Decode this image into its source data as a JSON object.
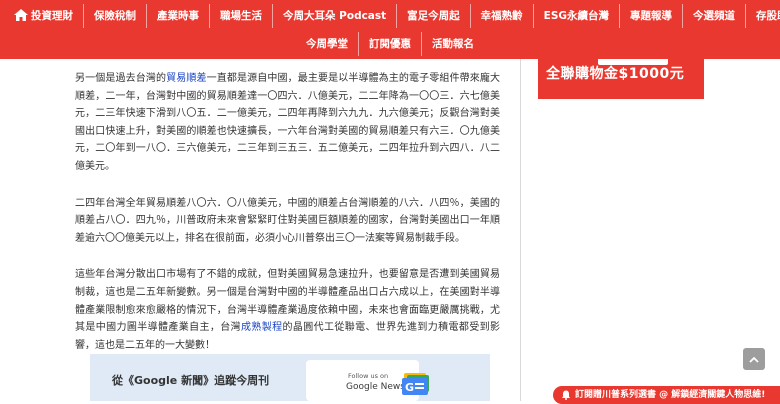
{
  "nav": {
    "row1": [
      "投資理財",
      "保險稅制",
      "產業時事",
      "職場生活",
      "今周大耳朵 Podcast",
      "富足今周起",
      "幸福熟齡",
      "ESG永續台灣",
      "專題報導",
      "今選頻道",
      "存股助理"
    ],
    "row2": [
      "今周學堂",
      "訂閱優惠",
      "活動報名"
    ]
  },
  "article": {
    "p1_a": "另一個是過去台灣的",
    "p1_link": "貿易順差",
    "p1_b": "一直都是源自中國，最主要是以半導體為主的電子零組件帶來龐大順差，二一年，台灣對中國的貿易順差達一〇四六．八億美元，二二年降為一〇〇三．六七億美元，二三年快速下滑到八〇五．二一億美元，二四年再降到六九九．九六億美元；反觀台灣對美國出口快速上升，對美國的順差也快速擴長，一六年台灣對美國的貿易順差只有六三．〇九億美元，二〇年到一八〇．三六億美元，二三年到三五三．五二億美元，二四年拉升到六四八．八二億美元。",
    "p2": "二四年台灣全年貿易順差八〇六．〇八億美元，中國的順差占台灣順差的八六．八四％，美國的順差占八〇．四九％，川普政府未來會緊緊盯住對美國巨額順差的國家，台灣對美國出口一年順差逾六〇〇億美元以上，排名在很前面，必須小心川普祭出三〇一法案等貿易制裁手段。",
    "p3_a": "這些年台灣分散出口市場有了不錯的成就，但對美國貿易急速拉升，也要留意是否遭到美國貿易制裁，這也是二五年新變數。另一個是台灣對中國的半導體產品出口占六成以上，在美國對半導體產業限制愈來愈嚴格的情況下，台灣半導體產業過度依賴中國，未來也會面臨更嚴厲挑戰，尤其是中國力圖半導體產業自主，台灣",
    "p3_link": "成熟製程",
    "p3_b": "的晶圓代工從聯電、世界先進到力積電都受到影響，這也是二五年的一大變數！"
  },
  "ad": {
    "headline": "全聯購物金$1000元"
  },
  "gnews": {
    "text": "從《Google 新聞》追蹤今周刊",
    "badge_follow": "Follow us on",
    "badge_name": "Google News"
  },
  "bottom_bar": {
    "text": "訂閱贈川普系列選書 @ 解鎖經濟關鍵人物思維!"
  },
  "colors": {
    "brand_red": "#e8382f",
    "link_blue": "#1a44c4",
    "panel_blue": "#dfeaf6"
  }
}
